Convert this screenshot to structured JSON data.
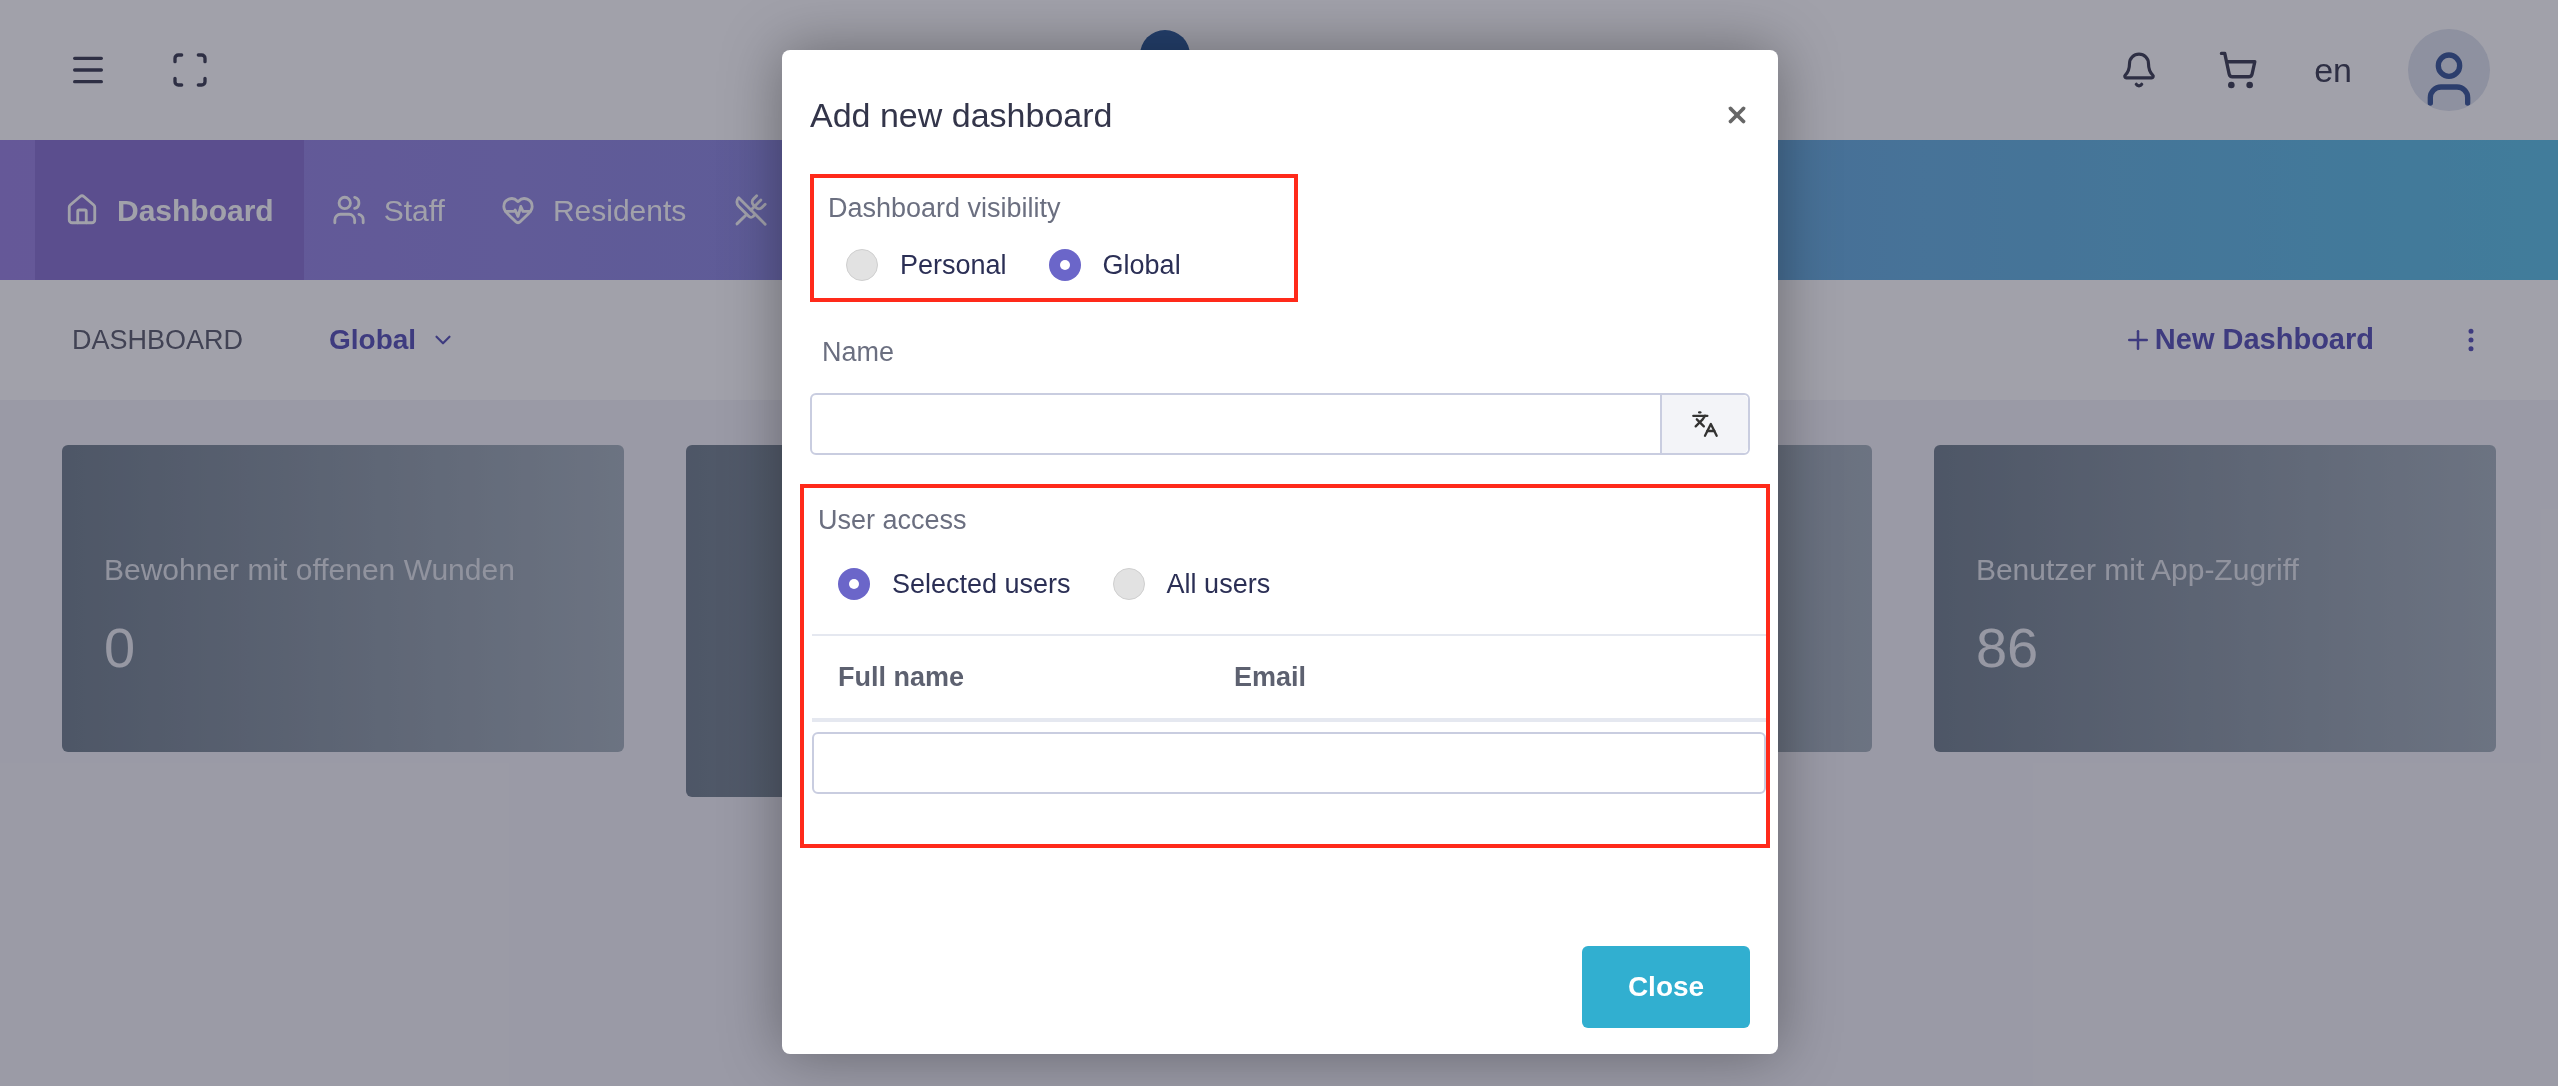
{
  "top_bar": {
    "language": "en"
  },
  "nav_tabs": [
    {
      "label": "Dashboard",
      "selected": true
    },
    {
      "label": "Staff",
      "selected": false
    },
    {
      "label": "Residents",
      "selected": false
    }
  ],
  "subheader": {
    "title": "DASHBOARD",
    "scope": "Global",
    "new_button": "New Dashboard"
  },
  "cards": [
    {
      "title": "Bewohner mit offenen Wunden",
      "value": "0"
    },
    {
      "title": "Benutzer mit App-Zugriff",
      "value": "86"
    }
  ],
  "modal": {
    "title": "Add new dashboard",
    "visibility": {
      "label": "Dashboard visibility",
      "options": [
        {
          "label": "Personal",
          "selected": false
        },
        {
          "label": "Global",
          "selected": true
        }
      ]
    },
    "name": {
      "label": "Name"
    },
    "user_access": {
      "label": "User access",
      "options": [
        {
          "label": "Selected users",
          "selected": true
        },
        {
          "label": "All users",
          "selected": false
        }
      ],
      "columns": [
        "Full name",
        "Email"
      ]
    },
    "close_button": "Close"
  }
}
